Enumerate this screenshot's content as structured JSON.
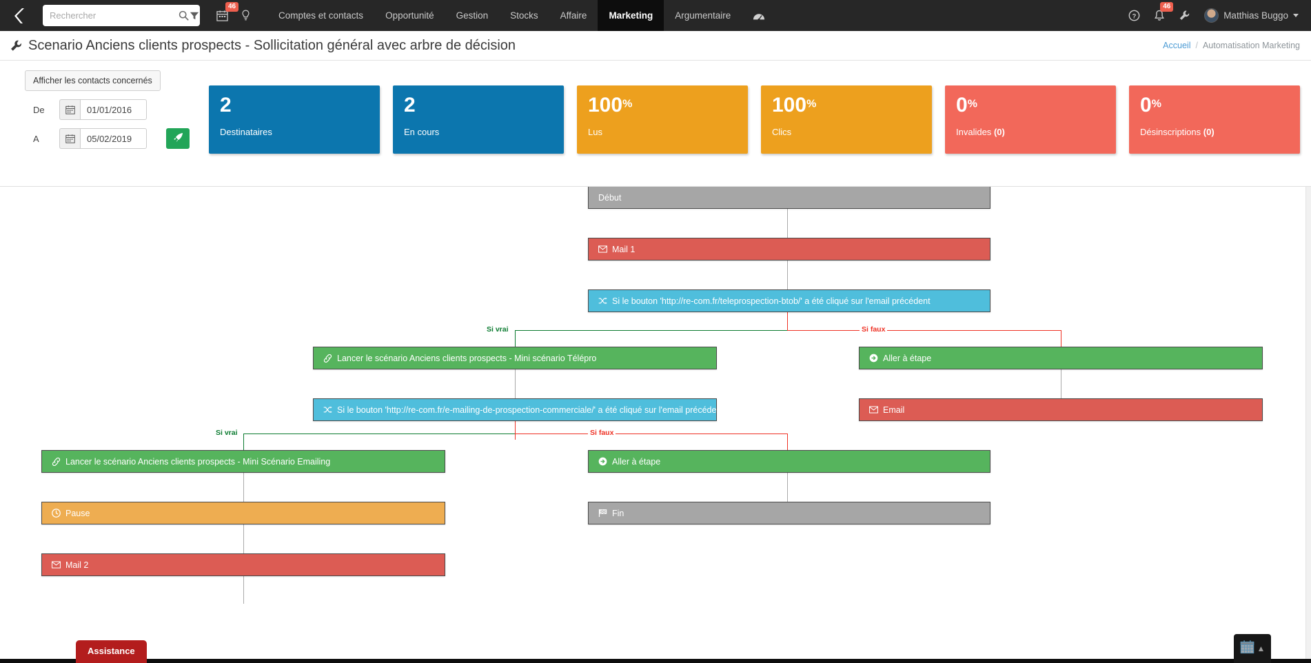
{
  "navbar": {
    "logo_icon": "k-logo-icon",
    "search": {
      "placeholder": "Rechercher",
      "value": "",
      "search_icon": "search-icon",
      "filter_icon": "filter-icon"
    },
    "left_icons": [
      {
        "name": "calendar-icon",
        "badge": "46"
      },
      {
        "name": "lightbulb-icon",
        "badge": ""
      }
    ],
    "menu": [
      {
        "label": "Comptes et contacts",
        "active": false
      },
      {
        "label": "Opportunité",
        "active": false
      },
      {
        "label": "Gestion",
        "active": false
      },
      {
        "label": "Stocks",
        "active": false
      },
      {
        "label": "Affaire",
        "active": false
      },
      {
        "label": "Marketing",
        "active": true
      },
      {
        "label": "Argumentaire",
        "active": false
      }
    ],
    "dashboard_icon": "dashboard-gauge-icon",
    "right": {
      "help_icon": "help-circle-icon",
      "bell_icon": "bell-icon",
      "bell_badge": "46",
      "wrench_icon": "wrench-icon",
      "user_name": "Matthias Buggo",
      "avatar": "user-avatar"
    }
  },
  "page": {
    "title": "Scenario Anciens clients prospects - Sollicitation général avec arbre de décision",
    "title_icon": "wrench-icon",
    "breadcrumb": {
      "home": "Accueil",
      "separator": "/",
      "current": "Automatisation Marketing"
    }
  },
  "filters": {
    "contacts_button": "Afficher les contacts concernés",
    "from_label": "De",
    "from_value": "01/01/2016",
    "to_label": "A",
    "to_value": "05/02/2019",
    "calendar_icon": "calendar-icon",
    "go_icon": "rocket-icon"
  },
  "kpis": [
    {
      "value": "2",
      "suffix": "",
      "label": "Destinataires",
      "label_bold": "",
      "color": "#0c76ae"
    },
    {
      "value": "2",
      "suffix": "",
      "label": "En cours",
      "label_bold": "",
      "color": "#0c76ae"
    },
    {
      "value": "100",
      "suffix": "%",
      "label": "Lus",
      "label_bold": "",
      "color": "#eda01e"
    },
    {
      "value": "100",
      "suffix": "%",
      "label": "Clics",
      "label_bold": "",
      "color": "#eda01e"
    },
    {
      "value": "0",
      "suffix": "%",
      "label": "Invalides",
      "label_bold": "(0)",
      "color": "#f2685a"
    },
    {
      "value": "0",
      "suffix": "%",
      "label": "Désinscriptions",
      "label_bold": "(0)",
      "color": "#f2685a"
    }
  ],
  "flow": {
    "nodes": {
      "debut": {
        "label": "Début",
        "icon": ""
      },
      "mail1": {
        "label": "Mail 1",
        "icon": "envelope-icon"
      },
      "cond1": {
        "label": "Si le bouton 'http://re-com.fr/teleprospection-btob/' a été cliqué sur l'email précédent",
        "icon": "shuffle-icon"
      },
      "scenario_telepro": {
        "label": "Lancer le scénario Anciens clients prospects - Mini scénario Télépro",
        "icon": "link-icon"
      },
      "aller_etape_1": {
        "label": "Aller à étape",
        "icon": "arrow-circle-right-icon"
      },
      "email_right": {
        "label": "Email",
        "icon": "envelope-icon"
      },
      "cond2": {
        "label": "Si le bouton 'http://re-com.fr/e-mailing-de-prospection-commerciale/' a été cliqué sur l'email précédent",
        "icon": "shuffle-icon"
      },
      "scenario_emailing": {
        "label": "Lancer le scénario Anciens clients prospects - Mini Scénario Emailing",
        "icon": "link-icon"
      },
      "aller_etape_2": {
        "label": "Aller à étape",
        "icon": "arrow-circle-right-icon"
      },
      "pause": {
        "label": "Pause",
        "icon": "clock-icon"
      },
      "fin": {
        "label": "Fin",
        "icon": "flag-icon"
      },
      "mail2": {
        "label": "Mail 2",
        "icon": "envelope-icon"
      }
    },
    "branch_labels": {
      "true_1": "Si vrai",
      "false_1": "Si faux",
      "true_2": "Si vrai",
      "false_2": "Si faux"
    }
  },
  "floating": {
    "assistance": "Assistance",
    "calendar_icon": "calendar-icon",
    "chevron_icon": "chevron-up-icon"
  }
}
